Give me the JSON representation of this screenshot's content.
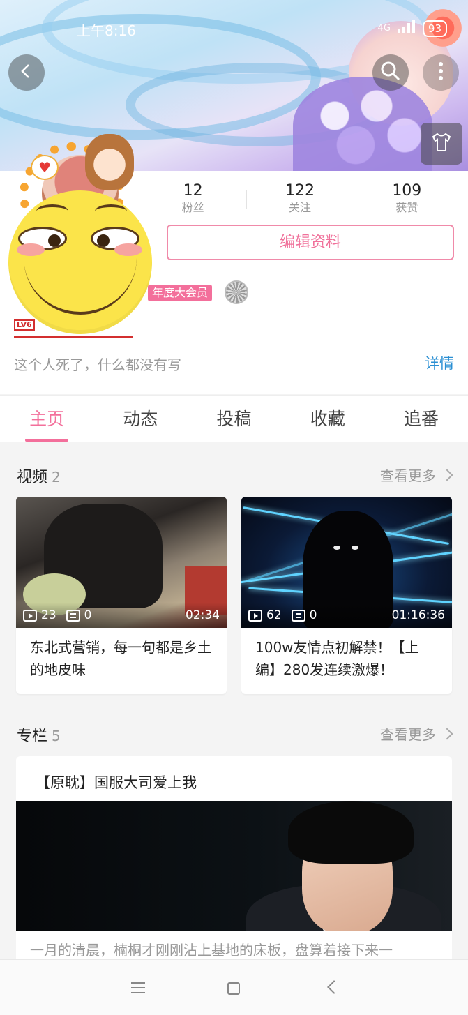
{
  "status_bar": {
    "time": "上午8:16",
    "network": "4G",
    "battery": "93"
  },
  "header": {
    "back_icon": "chevron-left-icon",
    "search_icon": "search-icon",
    "more_icon": "more-vertical-icon",
    "theme_icon": "tshirt-icon"
  },
  "profile": {
    "stats": [
      {
        "value": "12",
        "label": "粉丝"
      },
      {
        "value": "122",
        "label": "关注"
      },
      {
        "value": "109",
        "label": "获赞"
      }
    ],
    "edit_label": "编辑资料",
    "vip_label": "年度大会员",
    "level_label": "LV6",
    "bio": "这个人死了，什么都没有写",
    "detail_label": "详情",
    "accent_color": "#f36f9b",
    "link_color": "#2a8fd3"
  },
  "tabs": [
    {
      "label": "主页",
      "active": true
    },
    {
      "label": "动态",
      "active": false
    },
    {
      "label": "投稿",
      "active": false
    },
    {
      "label": "收藏",
      "active": false
    },
    {
      "label": "追番",
      "active": false
    }
  ],
  "videos_section": {
    "title": "视频",
    "count": "2",
    "more_label": "查看更多",
    "items": [
      {
        "plays": "23",
        "danmaku": "0",
        "duration": "02:34",
        "title": "东北式营销，每一句都是乡土的地皮味"
      },
      {
        "plays": "62",
        "danmaku": "0",
        "duration": "01:16:36",
        "title": "100w友情点初解禁！【上编】280发连续激爆！"
      }
    ]
  },
  "columns_section": {
    "title": "专栏",
    "count": "5",
    "more_label": "查看更多",
    "item": {
      "title": "【原耽】国服大司爱上我",
      "excerpt": "一月的清晨，楠桐才刚刚沾上基地的床板，盘算着接下来一"
    }
  },
  "nav_bar": {
    "menu_icon": "menu-icon",
    "home_icon": "square-home-icon",
    "back_icon": "back-triangle-icon"
  }
}
